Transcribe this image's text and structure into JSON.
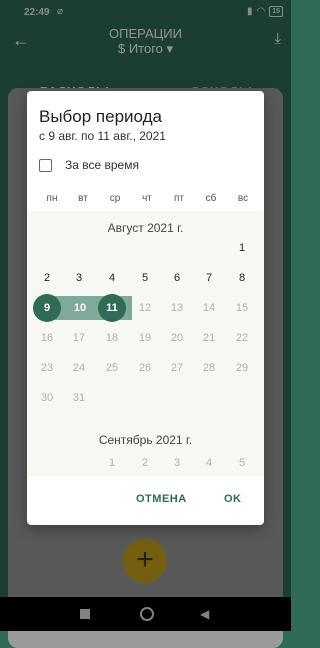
{
  "status": {
    "time": "22:49",
    "battery": "15"
  },
  "appbar": {
    "title": "ОПЕРАЦИИ",
    "subtitle": "Итого"
  },
  "tabs": [
    {
      "label": "РАСХОДЫ"
    },
    {
      "label": "ДОХОДЫ"
    }
  ],
  "fab": {
    "label": "+"
  },
  "dialog": {
    "title": "Выбор периода",
    "range": "с 9 авг. по 11 авг., 2021",
    "all_time": "За все время",
    "weekdays": [
      "пн",
      "вт",
      "ср",
      "чт",
      "пт",
      "сб",
      "вс"
    ],
    "august": {
      "title": "Август 2021 г.",
      "days": [
        "1",
        "2",
        "3",
        "4",
        "5",
        "6",
        "7",
        "8",
        "9",
        "10",
        "11",
        "12",
        "13",
        "14",
        "15",
        "16",
        "17",
        "18",
        "19",
        "20",
        "21",
        "22",
        "23",
        "24",
        "25",
        "26",
        "27",
        "28",
        "29",
        "30",
        "31"
      ]
    },
    "september": {
      "title": "Сентябрь 2021 г.",
      "days": [
        "1",
        "2",
        "3",
        "4",
        "5"
      ]
    },
    "cancel_label": "ОТМЕНА",
    "ok_label": "OK"
  }
}
